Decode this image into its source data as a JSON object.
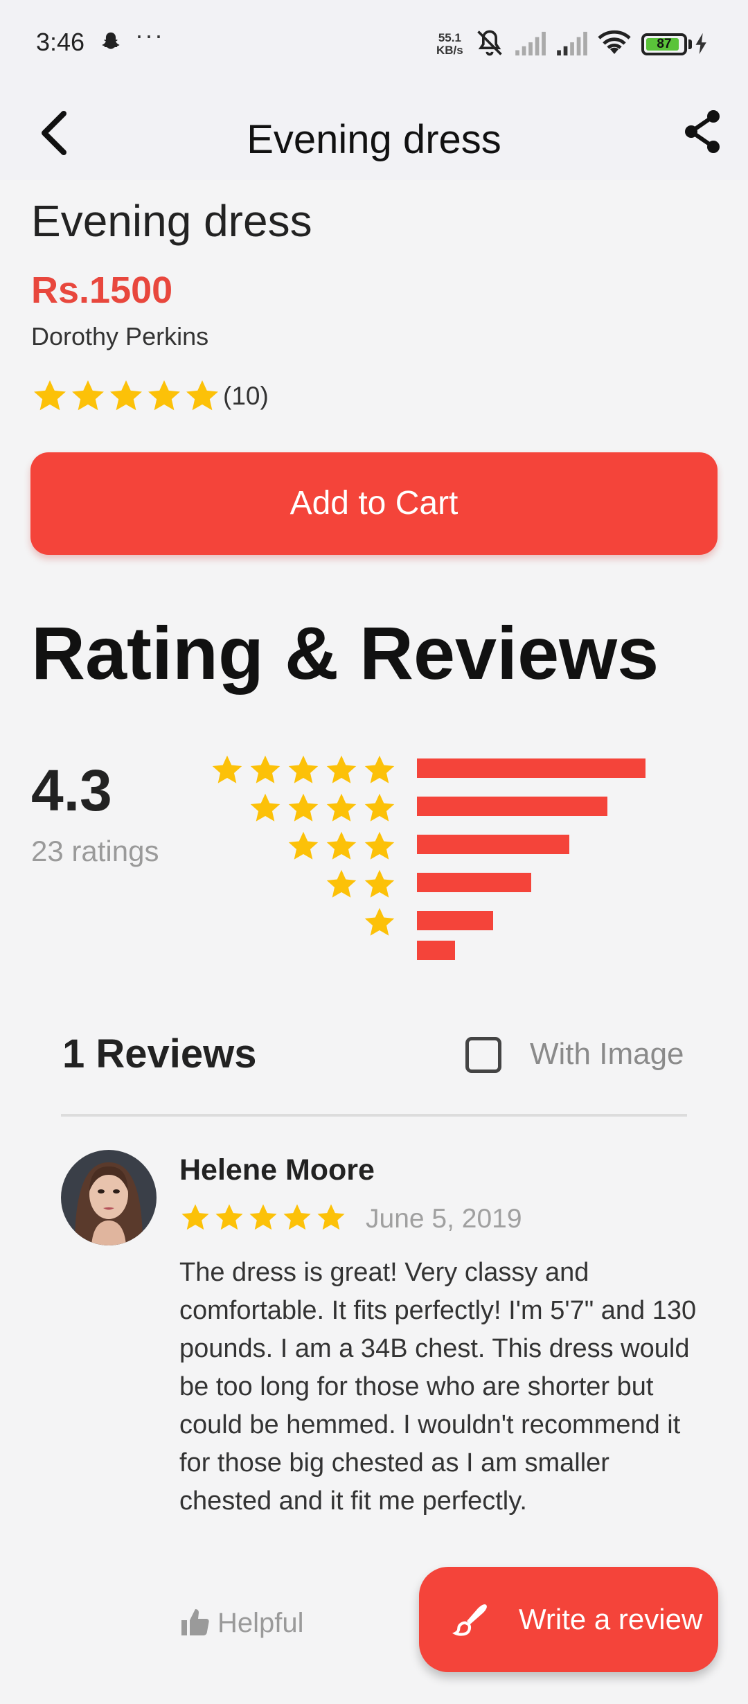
{
  "status_bar": {
    "time": "3:46",
    "speed_value": "55.1",
    "speed_unit": "KB/s",
    "battery": "87",
    "battery_level": 0.87,
    "icons": [
      "snapchat-icon",
      "more-dots-icon",
      "mute-icon",
      "signal-icon",
      "signal-icon",
      "wifi-icon",
      "battery-icon",
      "charging-icon"
    ]
  },
  "app_bar": {
    "title": "Evening dress",
    "back_icon": "back-arrow-icon",
    "share_icon": "share-icon"
  },
  "product": {
    "name": "Evening dress",
    "price": "Rs.1500",
    "brand": "Dorothy Perkins",
    "stars": 5,
    "review_count": "(10)",
    "add_to_cart": "Add to Cart"
  },
  "reviews_section": {
    "heading": "Rating & Reviews",
    "average": "4.3",
    "ratings_count": "23 ratings",
    "distribution": [
      {
        "stars": 5,
        "fraction": 1.0
      },
      {
        "stars": 4,
        "fraction": 0.833
      },
      {
        "stars": 3,
        "fraction": 0.667
      },
      {
        "stars": 2,
        "fraction": 0.5
      },
      {
        "stars": 1,
        "fraction": 0.333
      },
      {
        "stars": 0,
        "fraction": 0.167
      }
    ],
    "reviews_count": "1 Reviews",
    "with_image_label": "With Image",
    "with_image_checked": false
  },
  "review": {
    "author": "Helene Moore",
    "stars": 5,
    "date": "June 5, 2019",
    "text": "The dress is great! Very classy and comfortable. It fits perfectly! I'm 5'7\" and 130 pounds. I am a 34B chest. This dress would be too long for those who are shorter but could be hemmed. I wouldn't recommend it for those big chested as I am smaller chested and it fit me perfectly.",
    "helpful_label": "Helpful"
  },
  "fab": {
    "label": "Write a review",
    "icon": "brush-icon"
  },
  "colors": {
    "accent": "#f4443a",
    "price": "#e8473d",
    "star": "#fcc108",
    "muted": "#9a9a9a"
  }
}
